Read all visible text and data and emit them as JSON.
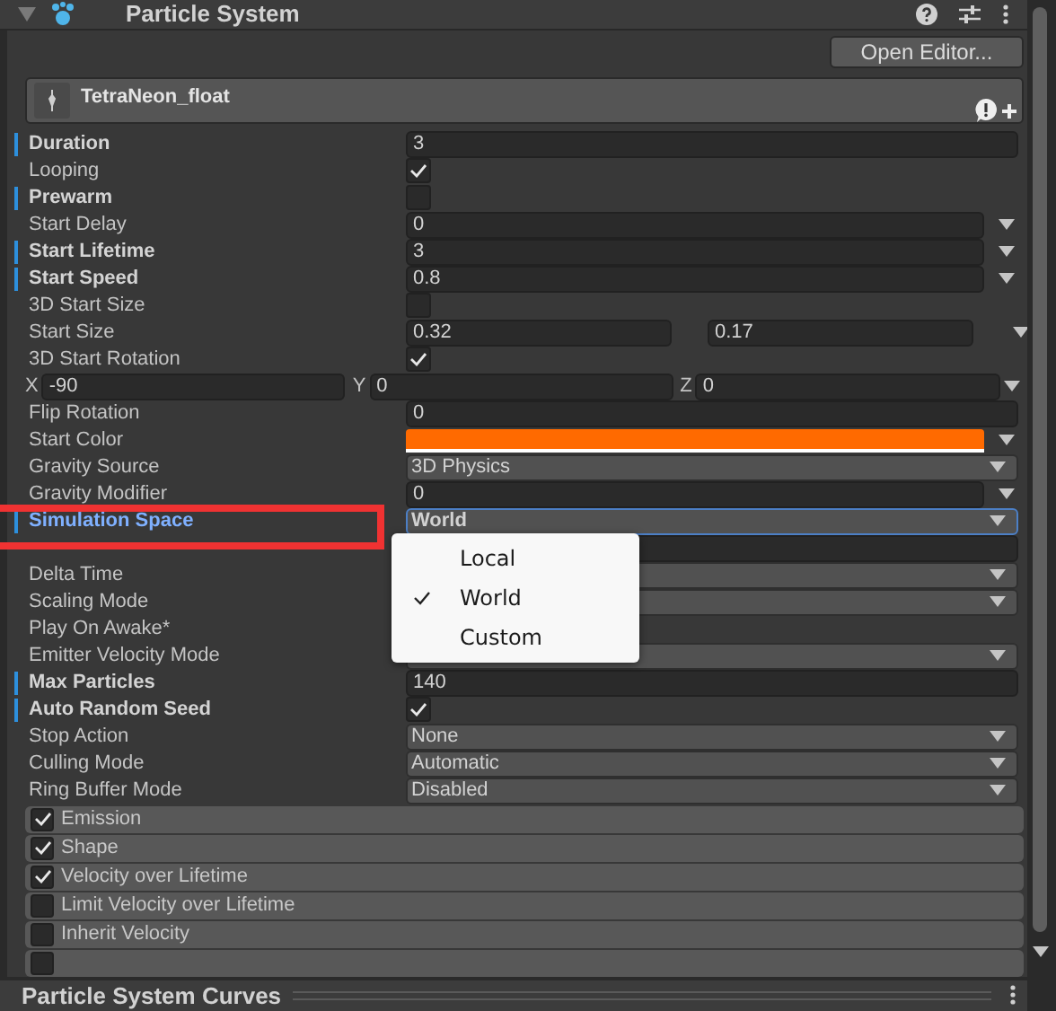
{
  "component": {
    "title": "Particle System",
    "expanded": true
  },
  "open_editor_button": "Open Editor...",
  "asset": {
    "name": "TetraNeon_float"
  },
  "rows": [
    {
      "kind": "field",
      "label": "Duration",
      "overridden": true,
      "value": "3"
    },
    {
      "kind": "checkbox",
      "label": "Looping",
      "overridden": false,
      "checked": true
    },
    {
      "kind": "checkbox",
      "label": "Prewarm",
      "overridden": true,
      "checked": false
    },
    {
      "kind": "curve",
      "label": "Start Delay",
      "overridden": false,
      "value": "0"
    },
    {
      "kind": "curve",
      "label": "Start Lifetime",
      "overridden": true,
      "value": "3"
    },
    {
      "kind": "curve",
      "label": "Start Speed",
      "overridden": true,
      "value": "0.8"
    },
    {
      "kind": "checkbox",
      "label": "3D Start Size",
      "overridden": false,
      "checked": false
    },
    {
      "kind": "pair",
      "label": "Start Size",
      "overridden": false,
      "values": [
        "0.32",
        "0.17"
      ]
    },
    {
      "kind": "checkbox",
      "label": "3D Start Rotation",
      "overridden": false,
      "checked": true
    },
    {
      "kind": "xyz",
      "axes": [
        {
          "axis": "X",
          "value": "-90"
        },
        {
          "axis": "Y",
          "value": "0"
        },
        {
          "axis": "Z",
          "value": "0"
        }
      ]
    },
    {
      "kind": "field",
      "label": "Flip Rotation",
      "overridden": false,
      "value": "0"
    },
    {
      "kind": "color",
      "label": "Start Color",
      "overridden": false,
      "color": "#ff6a00"
    },
    {
      "kind": "popup",
      "label": "Gravity Source",
      "overridden": false,
      "value": "3D Physics"
    },
    {
      "kind": "curve",
      "label": "Gravity Modifier",
      "overridden": false,
      "value": "0"
    },
    {
      "kind": "popup",
      "label": "Simulation Space",
      "overridden": true,
      "focused": true,
      "value": "World"
    },
    {
      "kind": "field"
    },
    {
      "kind": "popup",
      "label": "Delta Time",
      "overridden": false
    },
    {
      "kind": "popup",
      "label": "Scaling Mode",
      "overridden": false
    },
    {
      "kind": "blank",
      "label": "Play On Awake*",
      "overridden": false
    },
    {
      "kind": "popup",
      "label": "Emitter Velocity Mode",
      "overridden": false
    },
    {
      "kind": "field",
      "label": "Max Particles",
      "overridden": true,
      "value": "140"
    },
    {
      "kind": "checkbox",
      "label": "Auto Random Seed",
      "overridden": true,
      "checked": true
    },
    {
      "kind": "popup",
      "label": "Stop Action",
      "overridden": false,
      "value": "None"
    },
    {
      "kind": "popup",
      "label": "Culling Mode",
      "overridden": false,
      "value": "Automatic"
    },
    {
      "kind": "popup",
      "label": "Ring Buffer Mode",
      "overridden": false,
      "value": "Disabled"
    }
  ],
  "dropdown_menu": [
    {
      "label": "Local",
      "selected": false
    },
    {
      "label": "World",
      "selected": true
    },
    {
      "label": "Custom",
      "selected": false
    }
  ],
  "modules": [
    {
      "label": "Emission",
      "checked": true
    },
    {
      "label": "Shape",
      "checked": true
    },
    {
      "label": "Velocity over Lifetime",
      "checked": true
    },
    {
      "label": "Limit Velocity over Lifetime",
      "checked": false
    },
    {
      "label": "Inherit Velocity",
      "checked": false
    },
    {
      "checked": false
    }
  ],
  "curves_panel": {
    "title": "Particle System Curves"
  }
}
